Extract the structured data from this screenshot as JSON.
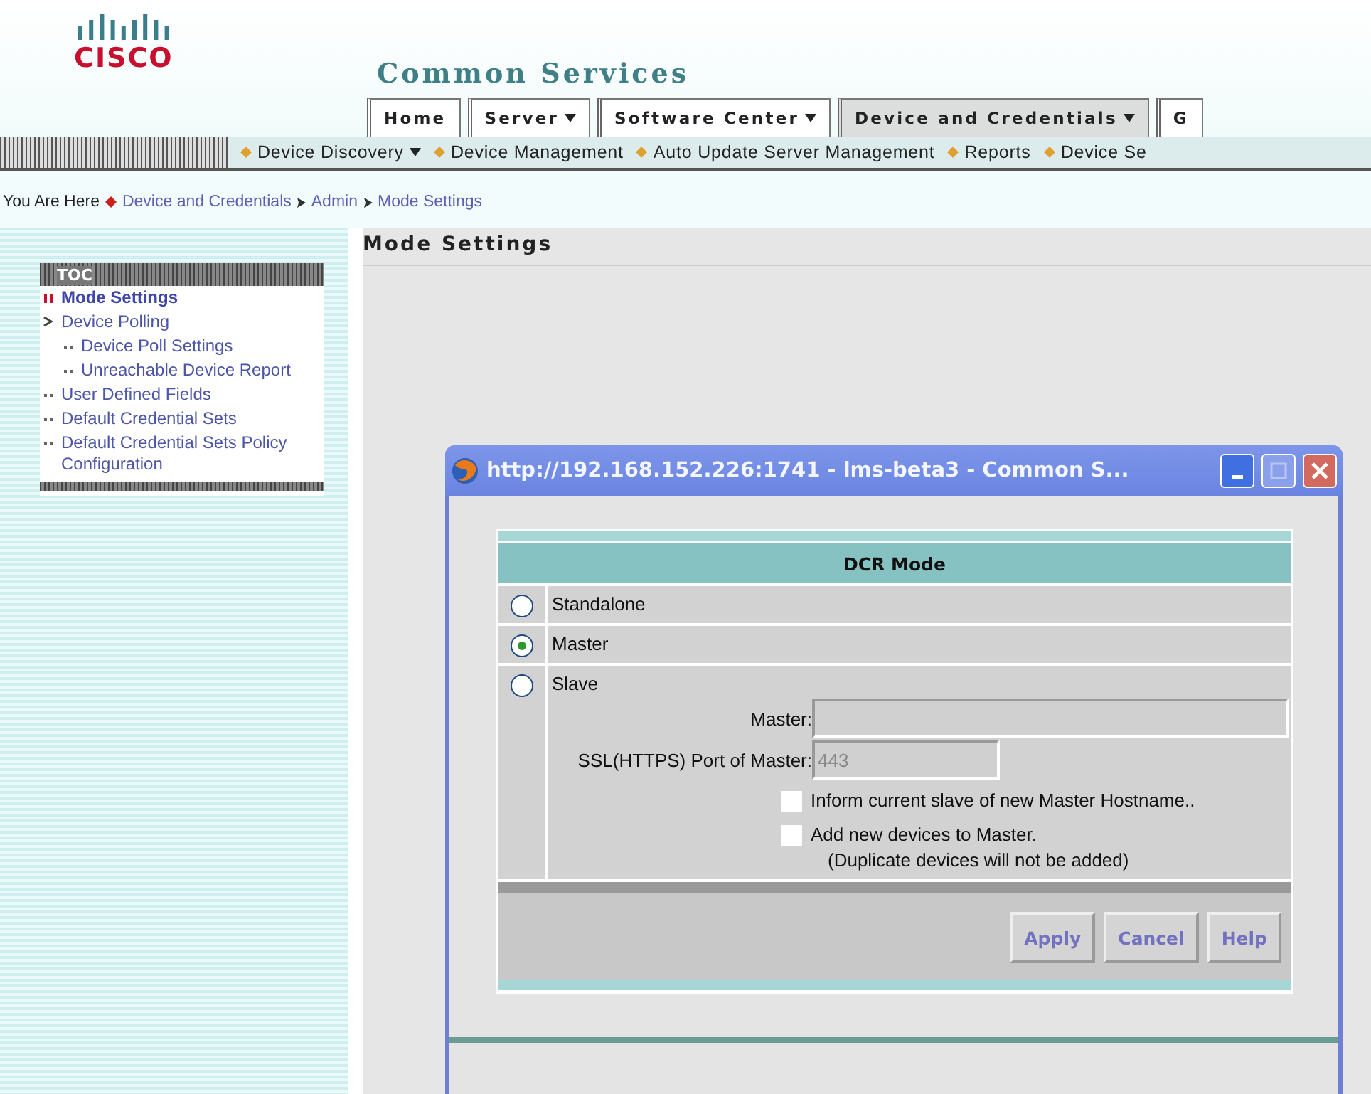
{
  "header": {
    "brand": "CISCO",
    "title": "Common Services"
  },
  "tabs": [
    {
      "label": "Home",
      "menu": false,
      "selected": false
    },
    {
      "label": "Server",
      "menu": true,
      "selected": false
    },
    {
      "label": "Software Center",
      "menu": true,
      "selected": false
    },
    {
      "label": "Device and Credentials",
      "menu": true,
      "selected": true
    },
    {
      "label": "G",
      "menu": false,
      "selected": false
    }
  ],
  "subnav": [
    {
      "label": "Device Discovery",
      "menu": true
    },
    {
      "label": "Device Management",
      "menu": false
    },
    {
      "label": "Auto Update Server Management",
      "menu": false
    },
    {
      "label": "Reports",
      "menu": false
    },
    {
      "label": "Device Se",
      "menu": false
    }
  ],
  "breadcrumb": {
    "label": "You Are Here",
    "items": [
      "Device and Credentials",
      "Admin",
      "Mode Settings"
    ]
  },
  "toc": {
    "title": "TOC",
    "items": [
      {
        "label": "Mode Settings",
        "selected": true
      },
      {
        "label": "Device Polling",
        "selected": false,
        "children": [
          {
            "label": "Device Poll Settings",
            "selected": false
          },
          {
            "label": "Unreachable Device Report",
            "selected": false
          }
        ]
      },
      {
        "label": "User Defined Fields",
        "selected": false
      },
      {
        "label": "Default Credential Sets",
        "selected": false
      },
      {
        "label": "Default Credential Sets Policy Configuration",
        "selected": false
      }
    ]
  },
  "page_title": "Mode Settings",
  "popup": {
    "title": "http://192.168.152.226:1741 - lms-beta3 - Common S...",
    "heading": "DCR Mode",
    "modes": [
      {
        "label": "Standalone",
        "selected": false
      },
      {
        "label": "Master",
        "selected": true
      },
      {
        "label": "Slave",
        "selected": false
      }
    ],
    "fields": [
      {
        "label": "Master:",
        "disabled": true,
        "wide": true
      },
      {
        "label": "SSL(HTTPS) Port of Master:",
        "value": "443",
        "disabled": true,
        "wide": false
      }
    ],
    "options": [
      {
        "label": "Inform current slave of new Master Hostname..",
        "checked": false
      },
      {
        "label": "Add new devices to Master.",
        "note": "(Duplicate devices will not be added)",
        "checked": false
      }
    ],
    "buttons": [
      "Apply",
      "Cancel",
      "Help"
    ]
  }
}
